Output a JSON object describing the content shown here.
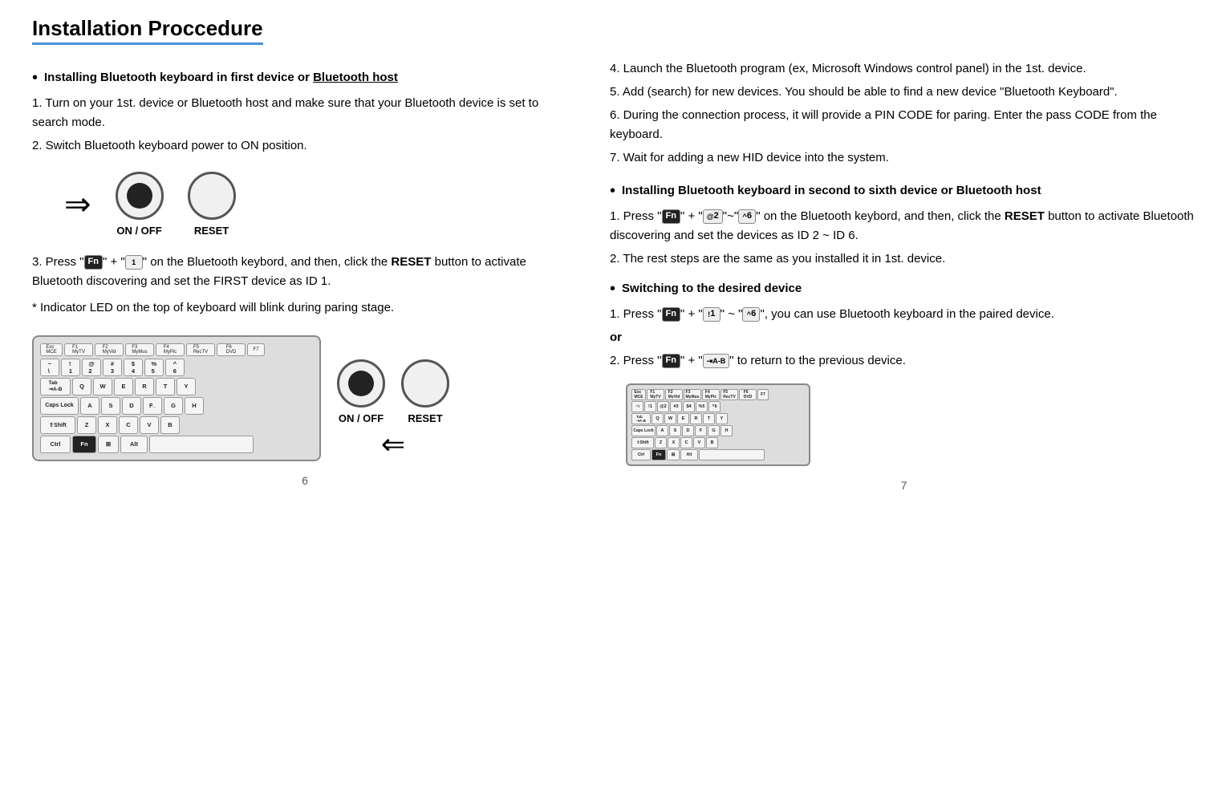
{
  "title": "Installation Proccedure",
  "left": {
    "section1_header": "Installing Bluetooth keyboard in first device or Bluetooth host",
    "steps_left": [
      "1. Turn on your 1st. device or Bluetooth host and make sure that your Bluetooth device is set to search mode.",
      "2. Switch Bluetooth keyboard power to ON position.",
      "3. Press \" Fn \" + \" 1 \" on the Bluetooth keybord, and then, click the RESET button to activate Bluetooth discovering and set the FIRST device as ID 1.",
      "* Indicator LED on the top of keyboard will blink during paring stage."
    ],
    "on_off_label": "ON / OFF",
    "reset_label": "RESET"
  },
  "right": {
    "steps_right": [
      "4. Launch the  Bluetooth program (ex, Microsoft Windows control panel) in the 1st. device.",
      "5. Add (search) for new devices. You should be able to find a new device “Bluetooth Keyboard”.",
      "6. During the connection process, it will provide a PIN CODE for paring. Enter the pass CODE from the keyboard.",
      "7. Wait for adding a new HID device into the system."
    ],
    "section2_header": "Installing Bluetooth keyboard in second to sixth device or Bluetooth host",
    "steps_section2": [
      "1. Press \" Fn \" + \" 2 \"~\" 6 \" on the Bluetooth keybord, and then, click the RESET button to activate Bluetooth discovering and set the devices as ID 2 ~ ID 6.",
      "2. The rest steps are the same as you installed it in 1st. device."
    ],
    "section3_header": "Switching to the desired device",
    "steps_section3": [
      "1. Press \" Fn \" + \" 1 \" ~ \" 6 \", you can use Bluetooth keyboard in the paired device.",
      "or",
      "2. Press \" Fn \" + \"                                       \" to return to the previous device."
    ],
    "on_off_label": "ON / OFF",
    "reset_label": "RESET"
  },
  "page_numbers": {
    "left": "6",
    "right": "7"
  },
  "keyboard": {
    "fn_row": [
      "Esc MCE",
      "F1 MyTV",
      "F2 MyVideos",
      "F3 MyMusic",
      "F4 MyPicture",
      "F5 RecordTV",
      "F6 DVD",
      "F7"
    ],
    "row1": [
      "~\\",
      "!1",
      "@2",
      "#3",
      "$4",
      "%5",
      "^6"
    ],
    "row2_labels": [
      "Tab",
      "Q",
      "W",
      "E",
      "R",
      "T",
      "Y"
    ],
    "row3_labels": [
      "Caps Lock",
      "A",
      "S",
      "D",
      "F",
      "G",
      "H"
    ],
    "row4_labels": [
      "Shift",
      "Z",
      "X",
      "C",
      "V",
      "B"
    ],
    "row5_labels": [
      "Ctrl",
      "Fn",
      "Win",
      "Alt",
      "(space)"
    ]
  }
}
